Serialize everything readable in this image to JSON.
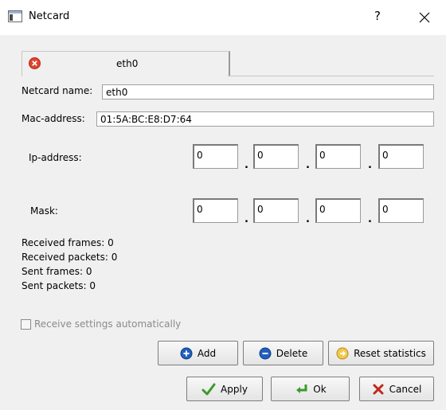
{
  "window": {
    "title": "Netcard",
    "help_glyph": "?",
    "close_glyph": "✕"
  },
  "tab": {
    "label": "eth0",
    "icon": "red-close-icon"
  },
  "form": {
    "netcard_name_label": "Netcard name:",
    "netcard_name_value": "eth0",
    "mac_label": "Mac-address:",
    "mac_value": "01:5A:BC:E8:D7:64",
    "ip_label": "Ip-address:",
    "ip_octets": [
      "0",
      "0",
      "0",
      "0"
    ],
    "mask_label": "Mask:",
    "mask_octets": [
      "0",
      "0",
      "0",
      "0"
    ],
    "separator": "."
  },
  "stats": {
    "received_frames": "Received frames: 0",
    "received_packets": "Received packets: 0",
    "sent_frames": "Sent frames: 0",
    "sent_packets": "Sent packets: 0"
  },
  "options": {
    "auto_settings_label": "Receive settings automatically",
    "auto_settings_checked": false,
    "auto_settings_enabled": false
  },
  "buttons": {
    "add": "Add",
    "delete": "Delete",
    "reset": "Reset statistics",
    "apply": "Apply",
    "ok": "Ok",
    "cancel": "Cancel"
  },
  "colors": {
    "accent_blue": "#1f5fbf",
    "close_red": "#e0442e",
    "apply_green": "#3b9a2a",
    "cancel_red": "#c0281c"
  }
}
